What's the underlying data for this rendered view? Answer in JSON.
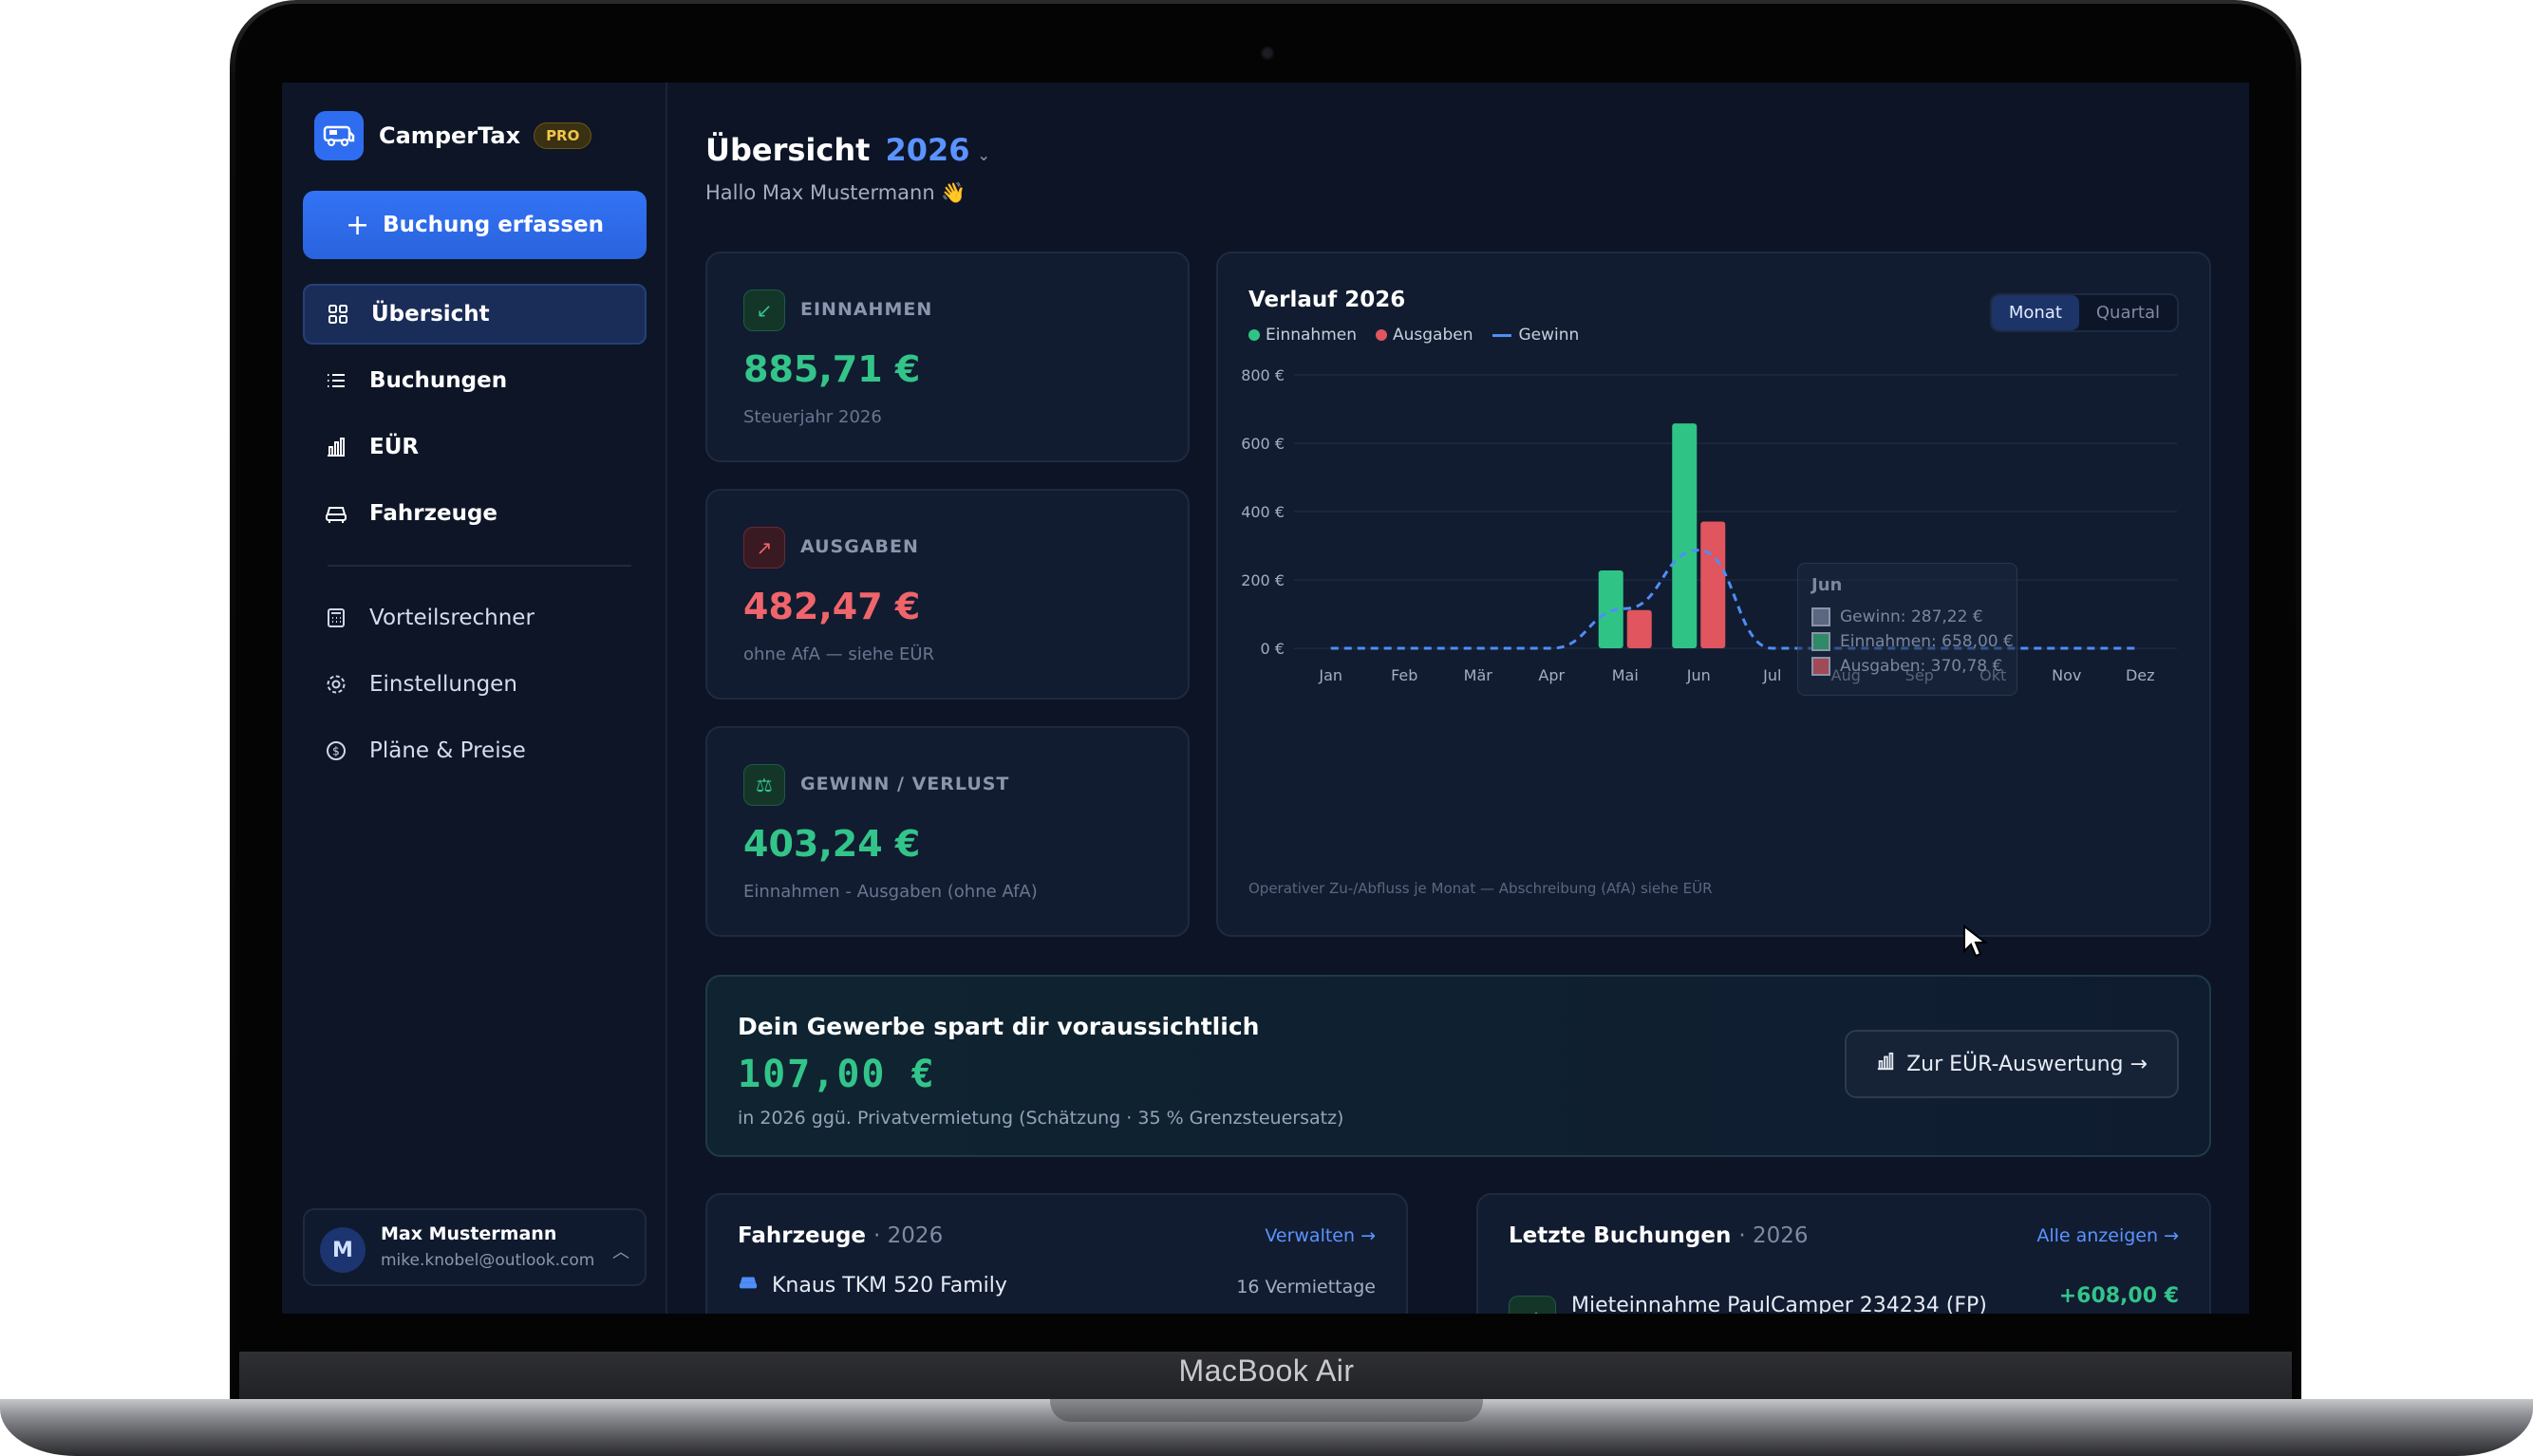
{
  "device": {
    "label": "MacBook Air"
  },
  "app": {
    "name": "CamperTax",
    "plan_badge": "PRO"
  },
  "sidebar": {
    "cta_label": "Buchung erfassen",
    "items": [
      {
        "label": "Übersicht",
        "icon": "grid-icon",
        "active": true
      },
      {
        "label": "Buchungen",
        "icon": "list-icon"
      },
      {
        "label": "EÜR",
        "icon": "bar-chart-icon"
      },
      {
        "label": "Fahrzeuge",
        "icon": "car-icon"
      },
      {
        "label": "Vorteilsrechner",
        "icon": "calculator-icon"
      },
      {
        "label": "Einstellungen",
        "icon": "gear-icon"
      },
      {
        "label": "Pläne & Preise",
        "icon": "dollar-icon"
      }
    ],
    "user": {
      "initial": "M",
      "name": "Max Mustermann",
      "email": "mike.knobel@outlook.com"
    }
  },
  "header": {
    "title": "Übersicht",
    "year": "2026",
    "greeting": "Hallo Max Mustermann 👋"
  },
  "kpis": [
    {
      "label": "EINNAHMEN",
      "value": "885,71 €",
      "sub": "Steuerjahr 2026",
      "color": "#33c48a"
    },
    {
      "label": "AUSGABEN",
      "value": "482,47 €",
      "sub": "ohne AfA — siehe EÜR",
      "color": "#f0646b"
    },
    {
      "label": "GEWINN / VERLUST",
      "value": "403,24 €",
      "sub": "Einnahmen - Ausgaben (ohne AfA)",
      "color": "#33c48a"
    }
  ],
  "chart": {
    "title": "Verlauf 2026",
    "toggle": [
      "Monat",
      "Quartal"
    ],
    "toggle_selected": "Monat",
    "note": "Operativer Zu-/Abfluss je Monat — Abschreibung (AfA) siehe EÜR",
    "tooltip": {
      "month": "Jun",
      "rows": [
        {
          "label": "Gewinn: 287,22 €",
          "color": "#5b6680"
        },
        {
          "label": "Einnahmen: 658,00 €",
          "color": "#2f8a68"
        },
        {
          "label": "Ausgaben: 370,78 €",
          "color": "#a04a55"
        }
      ]
    }
  },
  "chart_data": {
    "type": "bar",
    "categories": [
      "Jan",
      "Feb",
      "Mär",
      "Apr",
      "Mai",
      "Jun",
      "Jul",
      "Aug",
      "Sep",
      "Okt",
      "Nov",
      "Dez"
    ],
    "series": [
      {
        "name": "Einnahmen",
        "color": "#2fc486",
        "values": [
          0,
          0,
          0,
          0,
          227.71,
          658.0,
          0,
          0,
          0,
          0,
          0,
          0
        ]
      },
      {
        "name": "Ausgaben",
        "color": "#e0555e",
        "values": [
          0,
          0,
          0,
          0,
          111.69,
          370.78,
          0,
          0,
          0,
          0,
          0,
          0
        ]
      },
      {
        "name": "Gewinn",
        "color": "#4f8df7",
        "type": "line",
        "style": "dashed",
        "values": [
          0,
          0,
          0,
          0,
          116.02,
          287.22,
          0,
          0,
          0,
          0,
          0,
          0
        ]
      }
    ],
    "yticks": [
      "0 €",
      "200 €",
      "400 €",
      "600 €",
      "800 €"
    ],
    "ylim": [
      0,
      800
    ],
    "grid": true,
    "legend": "top-left"
  },
  "savings": {
    "title": "Dein Gewerbe spart dir voraussichtlich",
    "value": "107,00 €",
    "sub": "in 2026 ggü. Privatvermietung (Schätzung · 35 % Grenzsteuersatz)",
    "button_label": "Zur EÜR-Auswertung →"
  },
  "vehicles_panel": {
    "title": "Fahrzeuge",
    "year": "· 2026",
    "link": "Verwalten →",
    "row_label": "Knaus TKM 520 Family",
    "row_meta": "16 Vermiettage"
  },
  "bookings_panel": {
    "title": "Letzte Buchungen",
    "year": "· 2026",
    "link": "Alle anzeigen →",
    "row_label": "Mieteinnahme PaulCamper 234234 (FP)",
    "row_meta": "+608,00 €"
  }
}
